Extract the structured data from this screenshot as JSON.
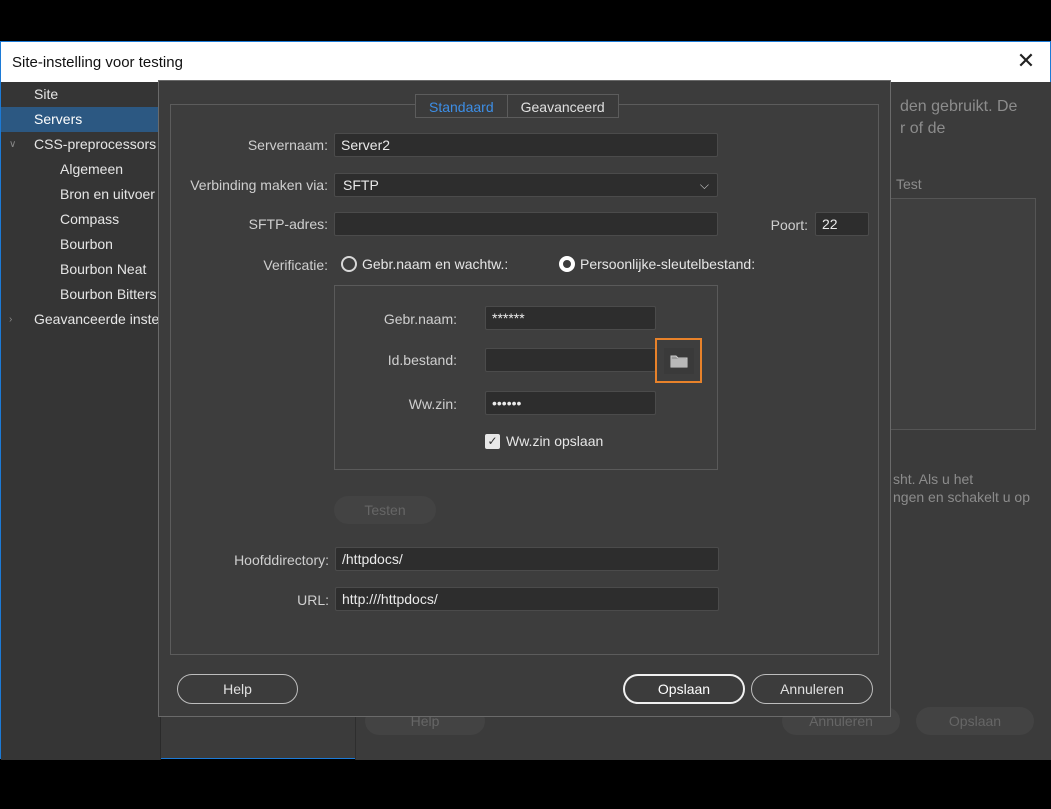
{
  "window": {
    "title": "Site-instelling voor testing",
    "close_glyph": "✕"
  },
  "sidebar": {
    "items": [
      {
        "label": "Site"
      },
      {
        "label": "Servers"
      },
      {
        "label": "CSS-preprocessors"
      },
      {
        "label": "Algemeen"
      },
      {
        "label": "Bron en uitvoer"
      },
      {
        "label": "Compass"
      },
      {
        "label": "Bourbon"
      },
      {
        "label": "Bourbon Neat"
      },
      {
        "label": "Bourbon Bitters"
      },
      {
        "label": "Geavanceerde instellingen"
      }
    ]
  },
  "background": {
    "text1": "den gebruikt. De",
    "text2": "r of de",
    "tab_test": "Test",
    "text3": "sht. Als u het",
    "text4": "ngen en schakelt u op",
    "help": "Help",
    "cancel": "Annuleren",
    "save": "Opslaan"
  },
  "dialog": {
    "tabs": [
      {
        "label": "Standaard"
      },
      {
        "label": "Geavanceerd"
      }
    ],
    "server_name_label": "Servernaam:",
    "server_name_value": "Server2",
    "connect_label": "Verbinding maken via:",
    "connect_value": "SFTP",
    "sftp_label": "SFTP-adres:",
    "sftp_value": "",
    "port_label": "Poort:",
    "port_value": "22",
    "auth_label": "Verificatie:",
    "auth_option1": "Gebr.naam en wachtw.:",
    "auth_option2": "Persoonlijke-sleutelbestand:",
    "username_label": "Gebr.naam:",
    "username_value": "******",
    "idfile_label": "Id.bestand:",
    "idfile_value": "",
    "passphrase_label": "Ww.zin:",
    "passphrase_value": "••••••",
    "save_passphrase_label": "Ww.zin opslaan",
    "test_button": "Testen",
    "rootdir_label": "Hoofddirectory:",
    "rootdir_value": "/httpdocs/",
    "url_label": "URL:",
    "url_value": "http:///httpdocs/",
    "help_button": "Help",
    "save_button": "Opslaan",
    "cancel_button": "Annuleren"
  },
  "colors": {
    "accent_blue": "#3d8ee6",
    "highlight_orange": "#e8822a",
    "selection": "#2c5882"
  }
}
